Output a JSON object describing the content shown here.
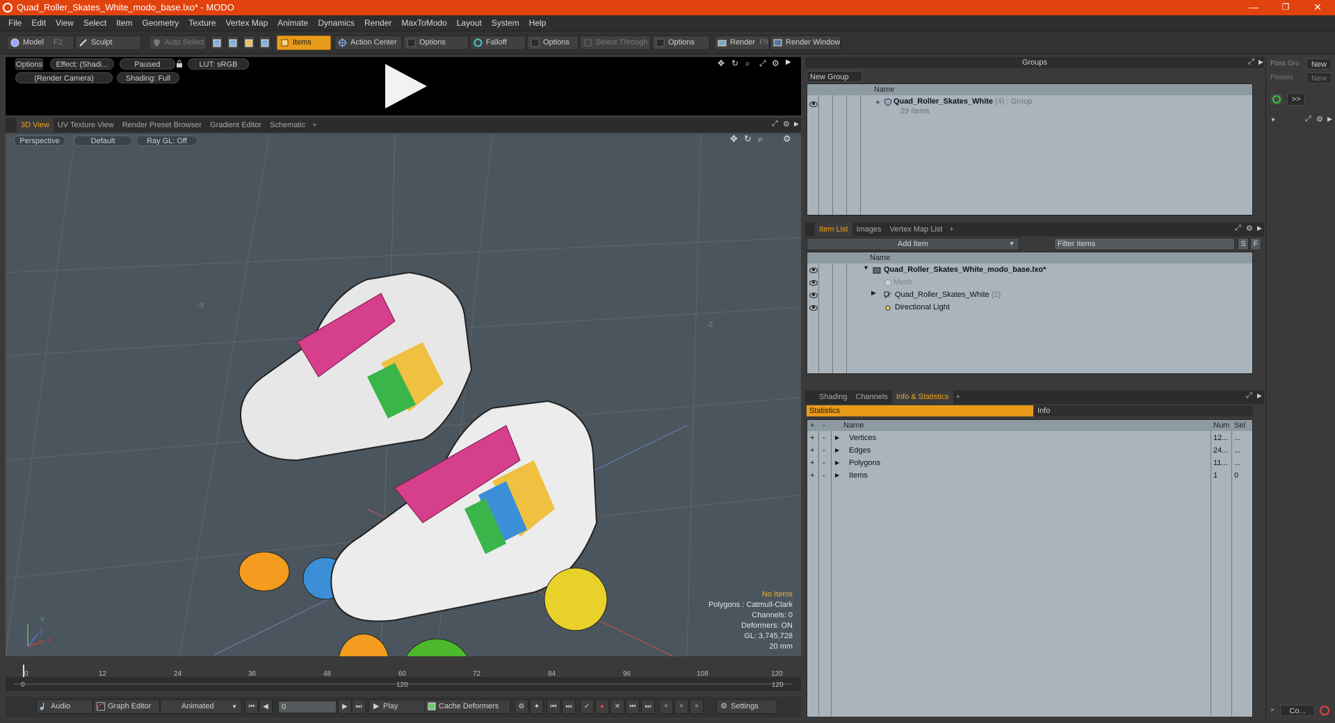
{
  "window": {
    "title": "Quad_Roller_Skates_White_modo_base.lxo* - MODO",
    "min": "—",
    "restore": "❐",
    "close": "✕"
  },
  "menu": [
    "File",
    "Edit",
    "View",
    "Select",
    "Item",
    "Geometry",
    "Texture",
    "Vertex Map",
    "Animate",
    "Dynamics",
    "Render",
    "MaxToModo",
    "Layout",
    "System",
    "Help"
  ],
  "toolbar": {
    "model": "Model",
    "model_key": "F2",
    "sculpt": "Sculpt",
    "auto_select": "Auto Select",
    "items": "Items",
    "action_center": "Action Center",
    "options1": "Options",
    "falloff": "Falloff",
    "options2": "Options",
    "select_through": "Select Through",
    "options3": "Options",
    "render": "Render",
    "render_key": "F9",
    "render_window": "Render Window"
  },
  "preview": {
    "options": "Options",
    "effect": "Effect: (Shadi...",
    "paused": "Paused",
    "lut": "LUT: sRGB",
    "camera": "(Render Camera)",
    "shading": "Shading: Full"
  },
  "viewport_tabs": [
    "3D View",
    "UV Texture View",
    "Render Preset Browser",
    "Gradient Editor",
    "Schematic",
    "+"
  ],
  "viewport": {
    "perspective": "Perspective",
    "default": "Default",
    "raygl": "Ray GL: Off",
    "stats": {
      "no_items": "No Items",
      "polygons": "Polygons : Catmull-Clark",
      "channels": "Channels: 0",
      "deformers": "Deformers: ON",
      "gl": "GL: 3,745,728",
      "size": "20 mm"
    },
    "axis_x": "X",
    "axis_y": "Y",
    "axis_z": "Z",
    "axis_x2": "-X",
    "axis_z2": "-Z"
  },
  "timeline": {
    "ticks": [
      "0",
      "12",
      "24",
      "36",
      "48",
      "60",
      "72",
      "84",
      "96",
      "108",
      "120"
    ],
    "lower_ticks": [
      "0",
      "120",
      "120"
    ]
  },
  "bottom": {
    "audio": "Audio",
    "graph_editor": "Graph Editor",
    "animated": "Animated",
    "frame": "0",
    "play": "Play",
    "cache_deformers": "Cache Deformers",
    "settings": "Settings"
  },
  "groups": {
    "header": "Groups",
    "new_group": "New Group",
    "col_name": "Name",
    "item_name": "Quad_Roller_Skates_White",
    "item_count": "(4)",
    "item_type": ": Group",
    "item_sub": "29 Items"
  },
  "passes": {
    "pass_label": "Pass Gro",
    "pass_new": "New",
    "passes_label": "Passes",
    "passes_new": "New",
    "arrow": ">>",
    "bottom_btn": "Co..."
  },
  "item_list": {
    "tabs": [
      "Item List",
      "Images",
      "Vertex Map List",
      "+"
    ],
    "add_item": "Add Item",
    "filter": "Filter Items",
    "s": "S",
    "f": "F",
    "col_name": "Name",
    "rows": [
      {
        "name": "Quad_Roller_Skates_White_modo_base.lxo*"
      },
      {
        "name": "Mesh"
      },
      {
        "name": "Quad_Roller_Skates_White",
        "count": "(2)"
      },
      {
        "name": "Directional Light"
      }
    ]
  },
  "info": {
    "tabs": [
      "Shading",
      "Channels",
      "Info & Statistics",
      "+"
    ],
    "statistics": "Statistics",
    "info": "Info",
    "col_name": "Name",
    "col_num": "Num",
    "col_sel": "Sel",
    "rows": [
      {
        "name": "Vertices",
        "num": "12...",
        "sel": "..."
      },
      {
        "name": "Edges",
        "num": "24...",
        "sel": "..."
      },
      {
        "name": "Polygons",
        "num": "11...",
        "sel": "..."
      },
      {
        "name": "Items",
        "num": "1",
        "sel": "0"
      }
    ]
  },
  "colors": {
    "accent": "#e89a1b",
    "titlebar": "#e2420e",
    "panel": "#a9b4bc",
    "viewport": "#4b555d"
  }
}
